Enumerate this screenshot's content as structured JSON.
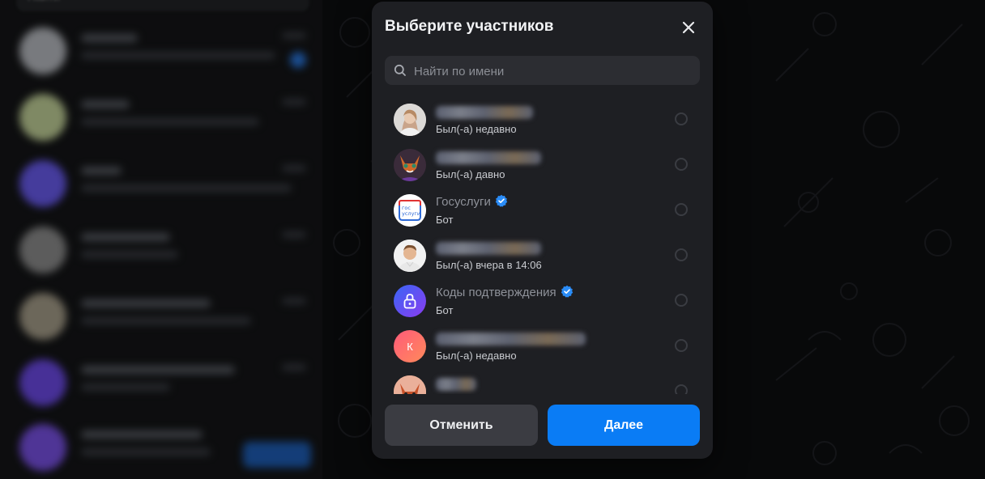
{
  "background": {
    "search_placeholder": "Найти"
  },
  "modal": {
    "title": "Выберите участников",
    "search": {
      "placeholder": "Найти по имени"
    },
    "contacts": [
      {
        "name": "",
        "status": "Был(-а) недавно",
        "avatar": "photo-woman",
        "verified": false
      },
      {
        "name": "",
        "status": "Был(-а) давно",
        "avatar": "photo-fox",
        "verified": false
      },
      {
        "name": "Госуслуги",
        "status": "Бот",
        "avatar": "gosuslugi-logo",
        "avatar_text": "гос\nуслуги",
        "verified": true
      },
      {
        "name": "",
        "status": "Был(-а) вчера в 14:06",
        "avatar": "photo-man",
        "verified": false
      },
      {
        "name": "Коды подтверждения",
        "status": "Бот",
        "avatar": "lock-icon",
        "verified": true
      },
      {
        "name": "",
        "status": "Был(-а) недавно",
        "avatar": "letter",
        "avatar_letter": "К",
        "verified": false
      },
      {
        "name": "",
        "status": "",
        "avatar": "photo-fox-2",
        "verified": false
      }
    ],
    "buttons": {
      "cancel": "Отменить",
      "next": "Далее"
    }
  },
  "colors": {
    "accent": "#0a7cf5",
    "verified": "#2a8cf7",
    "modal_bg": "#1e1f23"
  }
}
